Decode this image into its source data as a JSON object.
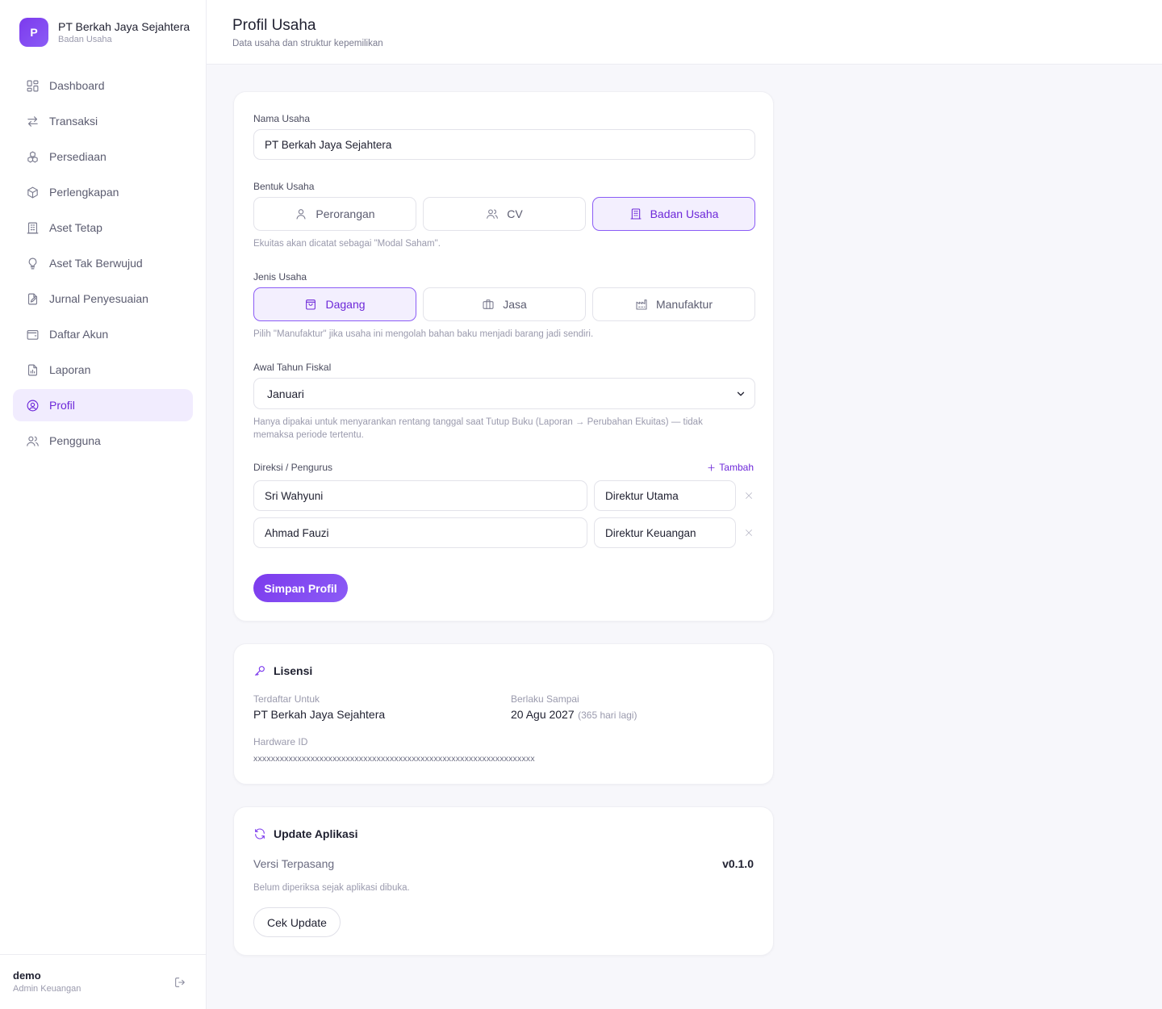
{
  "brand": {
    "logo_letter": "P",
    "name": "PT Berkah Jaya Sejahtera",
    "subtitle": "Badan Usaha"
  },
  "sidebar": {
    "items": [
      {
        "label": "Dashboard",
        "icon": "grid-icon",
        "active": false
      },
      {
        "label": "Transaksi",
        "icon": "arrows-exchange-icon",
        "active": false
      },
      {
        "label": "Persediaan",
        "icon": "boxes-icon",
        "active": false
      },
      {
        "label": "Perlengkapan",
        "icon": "package-icon",
        "active": false
      },
      {
        "label": "Aset Tetap",
        "icon": "building-icon",
        "active": false
      },
      {
        "label": "Aset Tak Berwujud",
        "icon": "lightbulb-icon",
        "active": false
      },
      {
        "label": "Jurnal Penyesuaian",
        "icon": "file-edit-icon",
        "active": false
      },
      {
        "label": "Daftar Akun",
        "icon": "wallet-icon",
        "active": false
      },
      {
        "label": "Laporan",
        "icon": "report-icon",
        "active": false
      },
      {
        "label": "Profil",
        "icon": "user-circle-icon",
        "active": true
      },
      {
        "label": "Pengguna",
        "icon": "users-icon",
        "active": false
      }
    ]
  },
  "user": {
    "name": "demo",
    "role": "Admin Keuangan"
  },
  "header": {
    "title": "Profil Usaha",
    "subtitle": "Data usaha dan struktur kepemilikan"
  },
  "form": {
    "nama_usaha_label": "Nama Usaha",
    "nama_usaha_value": "PT Berkah Jaya Sejahtera",
    "bentuk_usaha_label": "Bentuk Usaha",
    "bentuk_usaha_options": [
      {
        "label": "Perorangan",
        "icon": "user-icon",
        "selected": false
      },
      {
        "label": "CV",
        "icon": "users-icon",
        "selected": false
      },
      {
        "label": "Badan Usaha",
        "icon": "building-icon",
        "selected": true
      }
    ],
    "bentuk_usaha_hint": "Ekuitas akan dicatat sebagai \"Modal Saham\".",
    "jenis_usaha_label": "Jenis Usaha",
    "jenis_usaha_options": [
      {
        "label": "Dagang",
        "icon": "shopping-bag-icon",
        "selected": true
      },
      {
        "label": "Jasa",
        "icon": "briefcase-icon",
        "selected": false
      },
      {
        "label": "Manufaktur",
        "icon": "factory-icon",
        "selected": false
      }
    ],
    "jenis_usaha_hint": "Pilih \"Manufaktur\" jika usaha ini mengolah bahan baku menjadi barang jadi sendiri.",
    "fiskal_label": "Awal Tahun Fiskal",
    "fiskal_value": "Januari",
    "fiskal_hint": "Hanya dipakai untuk menyarankan rentang tanggal saat Tutup Buku (Laporan → Perubahan Ekuitas) — tidak memaksa periode tertentu.",
    "direksi_label": "Direksi / Pengurus",
    "tambah_label": "Tambah",
    "direksi": [
      {
        "name": "Sri Wahyuni",
        "role": "Direktur Utama"
      },
      {
        "name": "Ahmad Fauzi",
        "role": "Direktur Keuangan"
      }
    ],
    "save_label": "Simpan Profil"
  },
  "license": {
    "title": "Lisensi",
    "registered_label": "Terdaftar Untuk",
    "registered_value": "PT Berkah Jaya Sejahtera",
    "valid_label": "Berlaku Sampai",
    "valid_value": "20 Agu 2027",
    "valid_remaining": "(365 hari lagi)",
    "hardware_label": "Hardware ID",
    "hardware_value": "xxxxxxxxxxxxxxxxxxxxxxxxxxxxxxxxxxxxxxxxxxxxxxxxxxxxxxxxxxxxxxxx"
  },
  "update": {
    "title": "Update Aplikasi",
    "installed_label": "Versi Terpasang",
    "installed_value": "v0.1.0",
    "status_text": "Belum diperiksa sejak aplikasi dibuka.",
    "check_label": "Cek Update"
  },
  "colors": {
    "accent": "#7c3aed",
    "accent_bg": "#f1ecfe",
    "page_bg": "#f7f7fb"
  }
}
